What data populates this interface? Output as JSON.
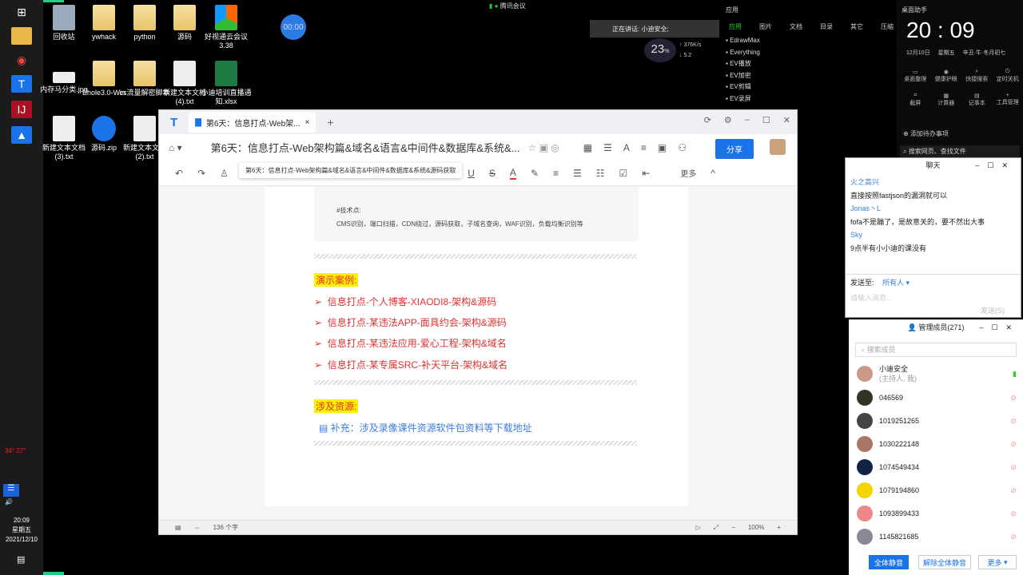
{
  "taskbar": {
    "clock_time": "20:09",
    "clock_day": "星期五",
    "clock_date": "2021/12/10",
    "tray_temp1": "34°",
    "tray_temp2": "27°"
  },
  "desktop": {
    "icons": [
      "回收站",
      "ywhack",
      "python",
      "源码",
      "好视通云会议3.38",
      "内存马分类.jpg",
      "Ehole3.0-Win",
      "cs流量解密脚本",
      "新建文本文档(4).txt",
      "小迪培训直播通知.xlsx",
      "新建文本文档(3).txt",
      "源码.zip",
      "新建文本文档(2).txt"
    ],
    "timer": "00:00"
  },
  "meeting": {
    "app": "腾讯会议",
    "speaking": "正在讲话: 小迪安全;",
    "cpu": "23",
    "cpu_unit": "%",
    "up": "376",
    "down": "5.2",
    "rate_unit": "K/s"
  },
  "apps_panel": {
    "title": "应用",
    "tabs": [
      "应用",
      "图片",
      "文档",
      "目录",
      "其它",
      "压缩"
    ],
    "items": [
      "EdrawMax",
      "Everything",
      "EV播放",
      "EV加密",
      "EV剪辑",
      "EV录屏"
    ]
  },
  "assistant": {
    "title": "桌面助手",
    "time": "20 : 09",
    "date": "12月10日",
    "weekday": "星期五",
    "lunar": "辛丑·牛·冬月初七",
    "tools": [
      "桌面整理",
      "健康护眼",
      "快捷搜索",
      "定时关机",
      "截屏",
      "计算器",
      "记事本",
      "工具管理"
    ],
    "add_todo": "添加待办事项",
    "search": "搜索网页、查找文件"
  },
  "doc": {
    "tab_label": "第6天：信息打点-Web架...",
    "title": "第6天：信息打点-Web架构篇&域名&语言&中间件&数据库&系统&...",
    "tooltip": "第6天：信息打点-Web架构篇&域名&语言&中间件&数据库&系统&源码获取",
    "share": "分享",
    "more": "更多",
    "code_label": "#技术点:",
    "code_text": "CMS识别，端口扫描，CDN绕过，源码获取，子域名查询，WAF识别，负载均衡识别等",
    "demo_heading": "演示案例:",
    "demo_items": [
      "信息打点-个人博客-XIAODI8-架构&源码",
      "信息打点-某违法APP-面具约会-架构&源码",
      "信息打点-某违法应用-爱心工程-架构&域名",
      "信息打点-某专属SRC-补天平台-架构&域名"
    ],
    "resource_heading": "涉及资源:",
    "resource_link": "补充：涉及录像课件资源软件包资料等下载地址",
    "word_count": "136 个字",
    "zoom": "100%"
  },
  "chat": {
    "title": "聊天",
    "messages": [
      {
        "name": "火之高兴",
        "text": "直接按照fastjson的漏洞就可以"
      },
      {
        "name": "Jonas丶L",
        "text": "fofa不是蹦了，是故意关的，要不然出大事"
      },
      {
        "name": "Sky",
        "text": "9点半有小小迪的课没有"
      }
    ],
    "send_to_label": "发送至:",
    "send_to": "所有人",
    "placeholder": "请输入消息...",
    "send": "发送(S)"
  },
  "members": {
    "title": "管理成员(271)",
    "search_placeholder": "搜索成员",
    "host": "小迪安全",
    "host_role": "(主持人, 我)",
    "list": [
      "046569",
      "1019251265",
      "1030222148",
      "1074549434",
      "1079194860",
      "1093899433",
      "1145821685"
    ],
    "mute_all": "全体静音",
    "unmute_all": "解除全体静音",
    "more": "更多"
  }
}
